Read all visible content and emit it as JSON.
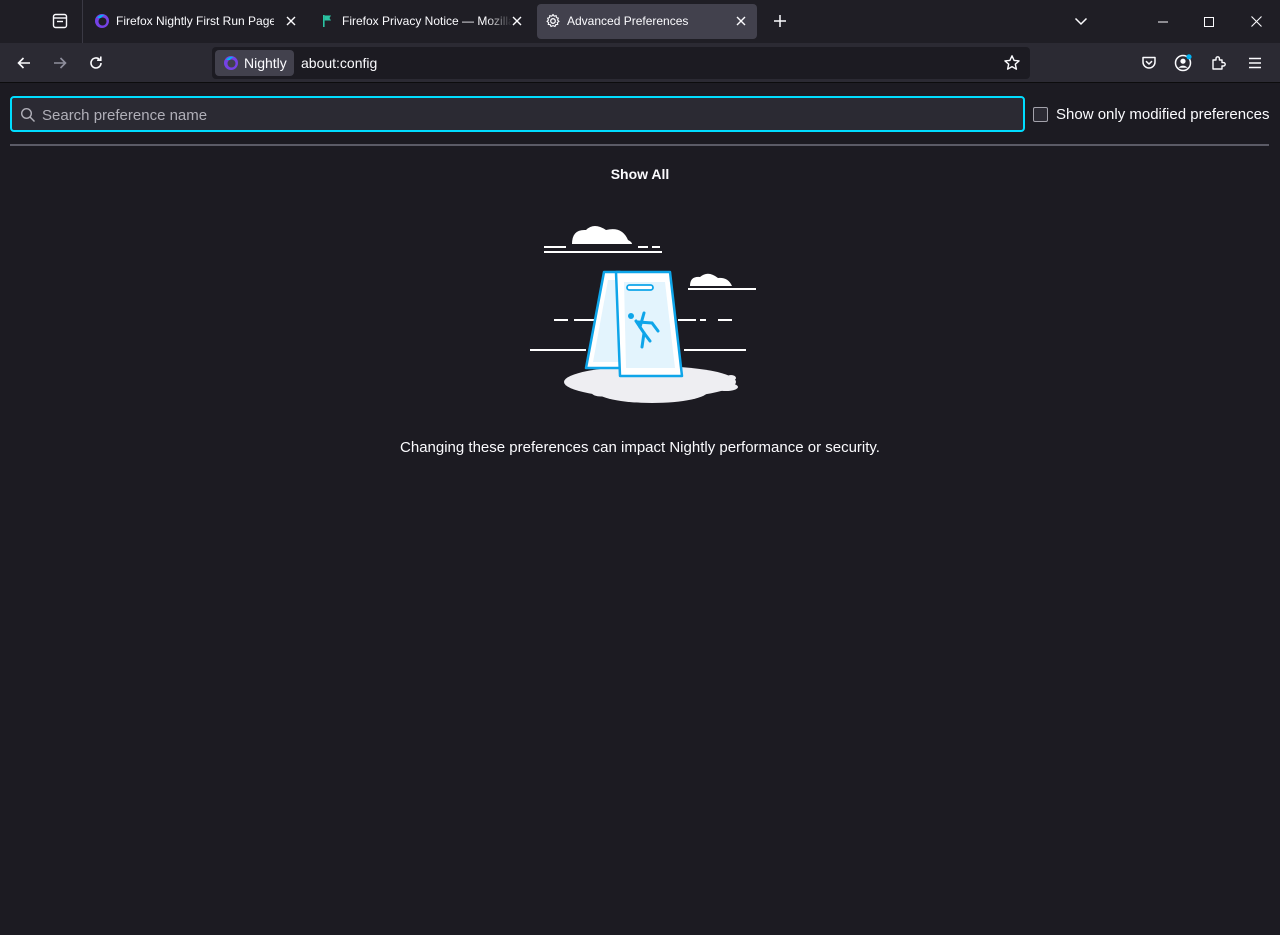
{
  "tabs": [
    {
      "title": "Firefox Nightly First Run Page",
      "icon": "nightly-logo-icon"
    },
    {
      "title": "Firefox Privacy Notice — Mozilla",
      "icon": "mozilla-flag-icon"
    },
    {
      "title": "Advanced Preferences",
      "icon": "gear-icon",
      "active": true
    }
  ],
  "urlbar": {
    "identity_label": "Nightly",
    "url": "about:config"
  },
  "config": {
    "search_placeholder": "Search preference name",
    "modified_only_label": "Show only modified preferences",
    "modified_only_checked": false,
    "show_all_label": "Show All",
    "warning_text": "Changing these preferences can impact Nightly performance or security."
  },
  "colors": {
    "accent": "#00ddff",
    "background": "#1c1b22",
    "toolbar": "#2b2a33",
    "illustration_blue": "#0ea5e9"
  }
}
